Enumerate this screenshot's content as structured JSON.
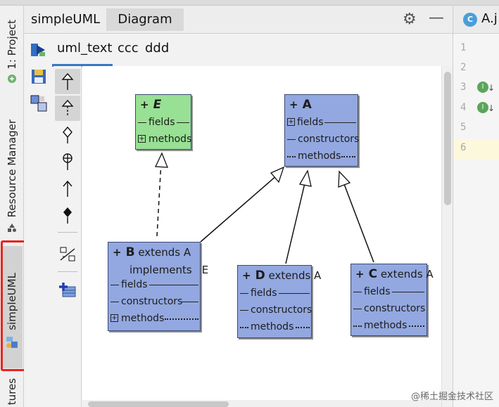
{
  "left_strip": {
    "project_label": "1: Project",
    "resource_label": "Resource Manager",
    "simpleuml_label": "simpleUML",
    "structures_label": "tures"
  },
  "tool_window": {
    "tabs": [
      "simpleUML",
      "Diagram"
    ],
    "sub_tabs": [
      "uml_text",
      "ccc",
      "ddd"
    ]
  },
  "diagram": {
    "classes": {
      "E": {
        "name": "E",
        "fields": "fields",
        "methods": "methods"
      },
      "A": {
        "name": "A",
        "fields": "fields",
        "constructors": "constructors",
        "methods": "methods"
      },
      "B": {
        "name": "B",
        "extends": "extends A",
        "implements": "implements",
        "implements_name": "E",
        "fields": "fields",
        "constructors": "constructors",
        "methods": "methods"
      },
      "D": {
        "name": "D",
        "extends": "extends A",
        "fields": "fields",
        "constructors": "constructors",
        "methods": "methods"
      },
      "C": {
        "name": "C",
        "extends": "extends A",
        "fields": "fields",
        "constructors": "constructors",
        "methods": "methods"
      }
    },
    "colors": {
      "interface_fill": "#98e094",
      "class_fill": "#93a8e0"
    }
  },
  "editor": {
    "file_name": "A.j",
    "file_icon": "C",
    "line_numbers": [
      "1",
      "2",
      "3",
      "4",
      "5",
      "6"
    ]
  },
  "watermark": "@稀土掘金技术社区",
  "colors": {
    "highlight_red": "#e8231f",
    "accent_blue": "#3a76c4"
  }
}
